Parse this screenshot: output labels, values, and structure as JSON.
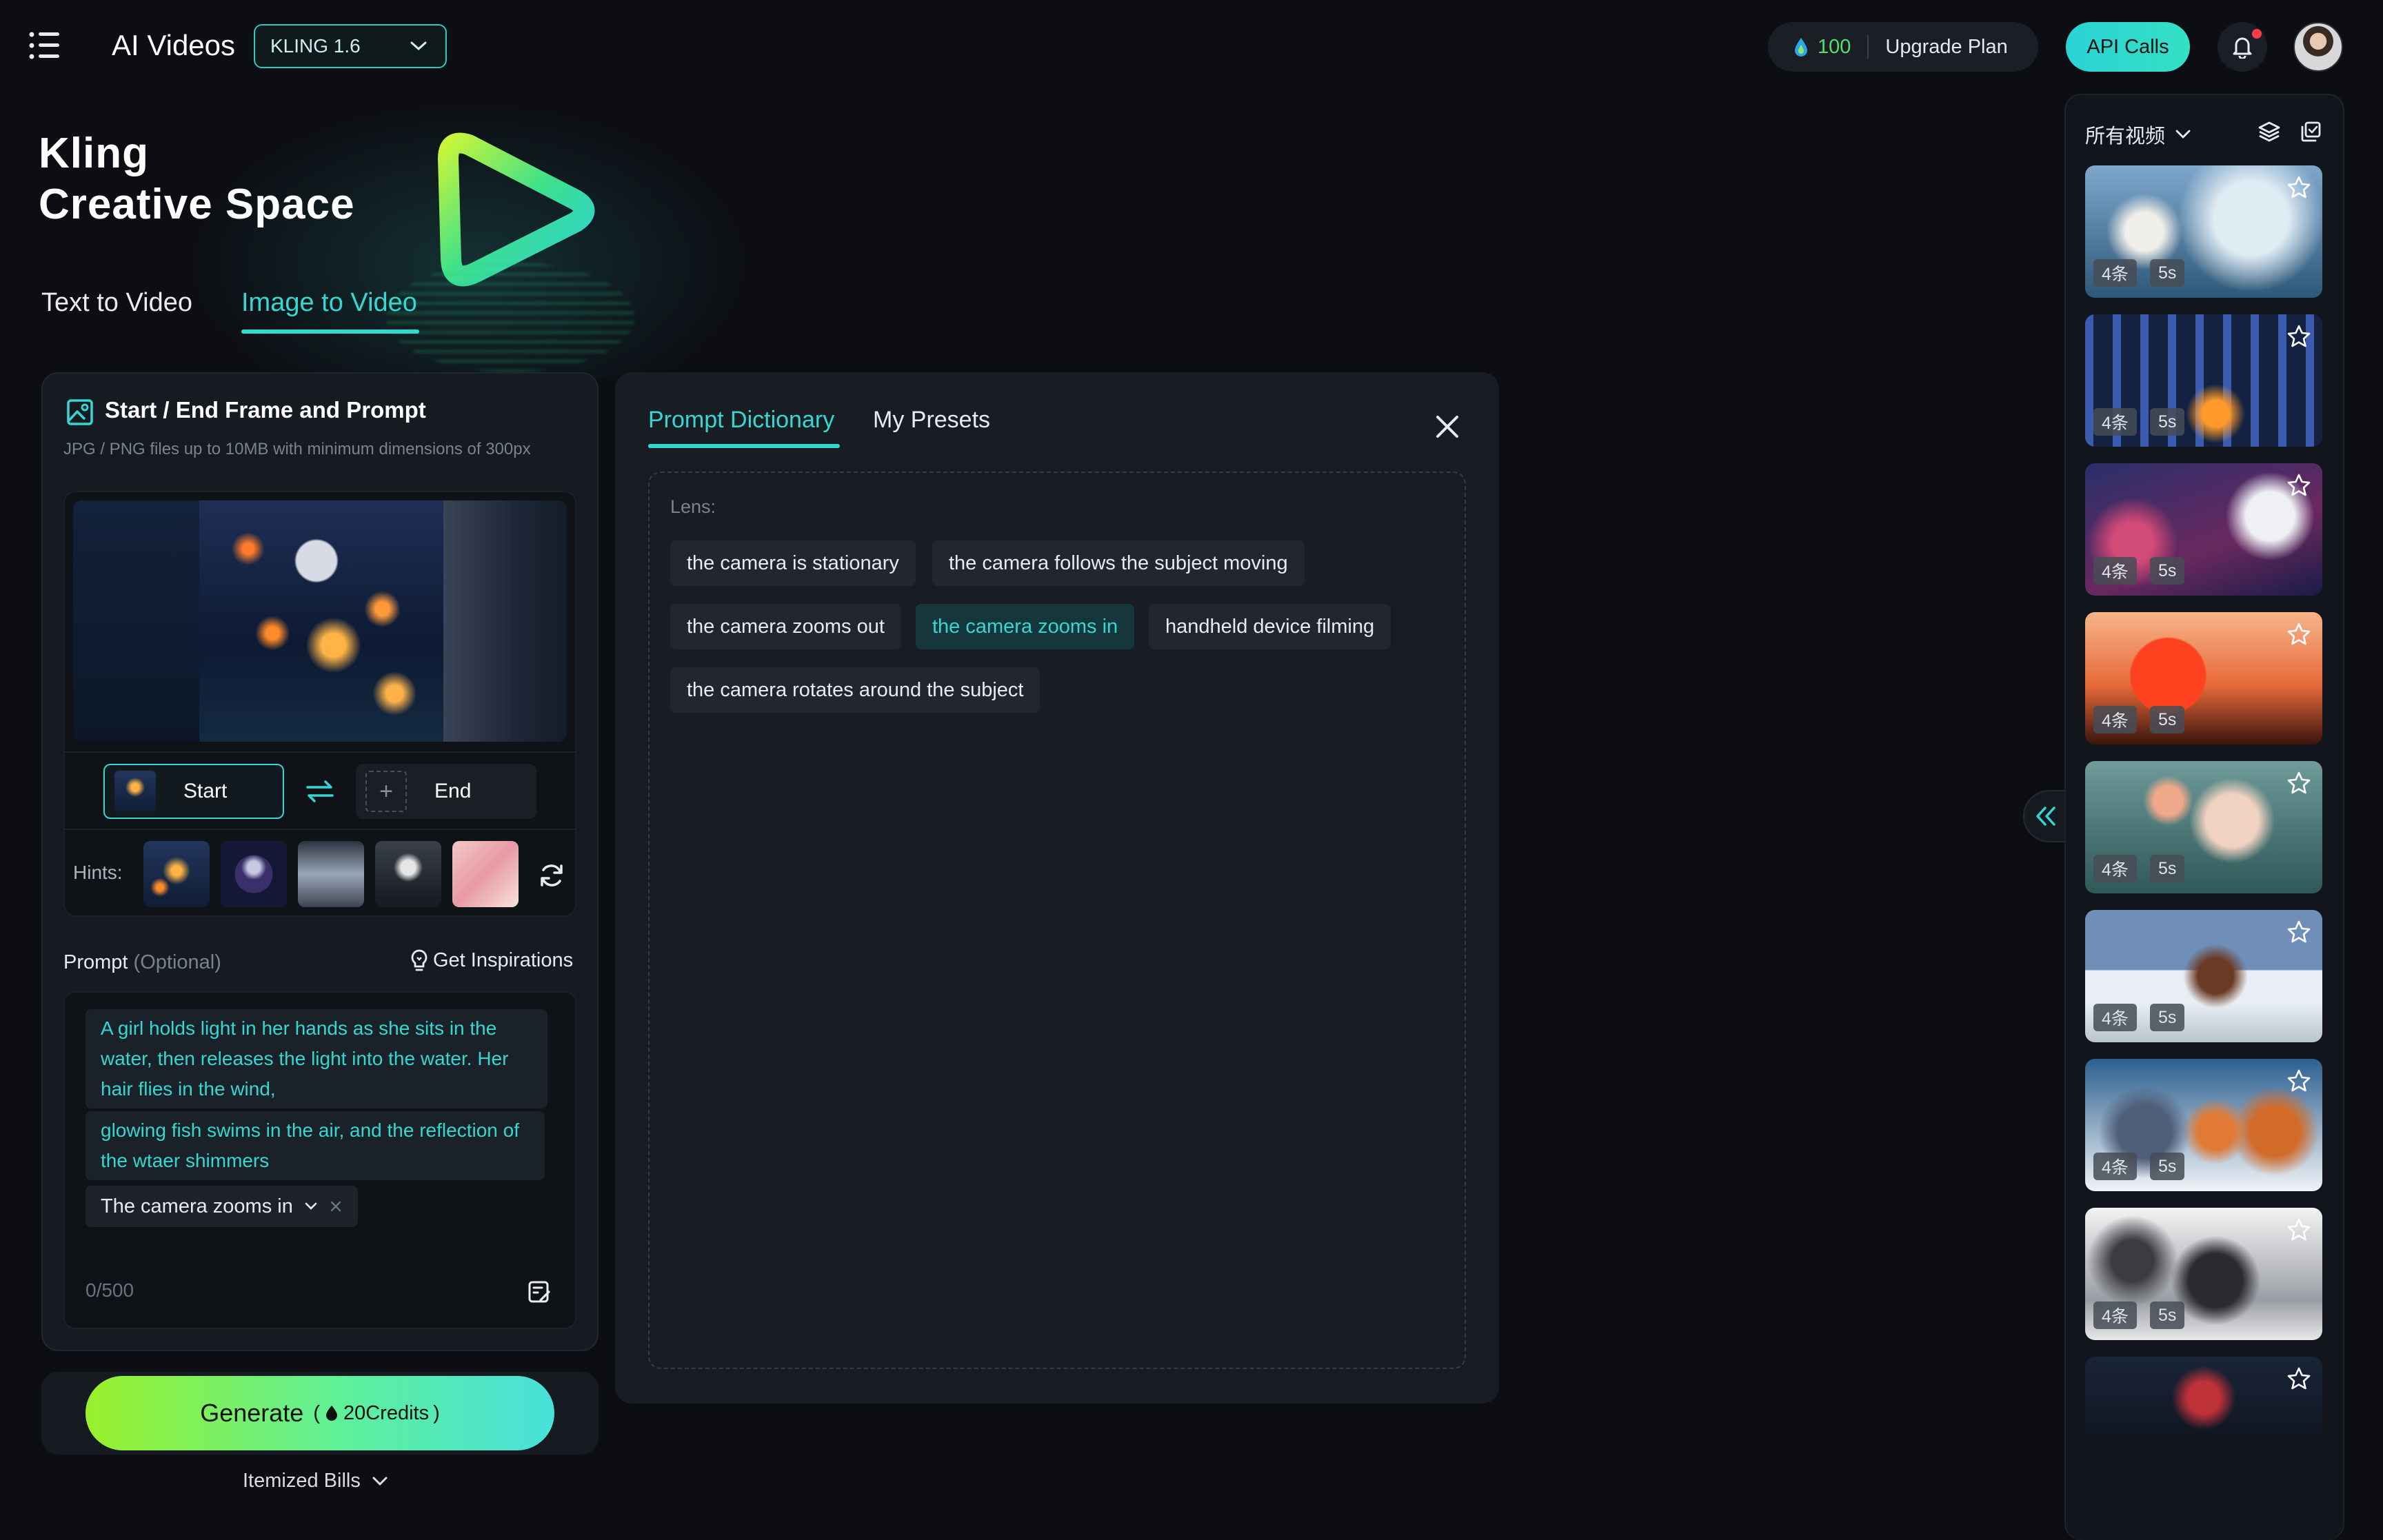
{
  "header": {
    "app_title": "AI Videos",
    "model_select": "KLING 1.6",
    "credits": "100",
    "upgrade_label": "Upgrade Plan",
    "api_label": "API Calls"
  },
  "hero": {
    "title_line1": "Kling",
    "title_line2": "Creative Space",
    "tabs": [
      "Text to Video",
      "Image to Video"
    ],
    "active_tab": "Image to Video"
  },
  "frame_panel": {
    "title": "Start / End Frame and Prompt",
    "subtitle": "JPG / PNG files up to 10MB with minimum dimensions of 300px",
    "start_label": "Start",
    "end_label": "End",
    "hints_label": "Hints:"
  },
  "prompt": {
    "label": "Prompt",
    "optional": "(Optional)",
    "inspirations": "Get Inspirations",
    "chunk1": "A girl holds light in her hands as she sits in the water, then releases the light into the water. Her hair flies in the wind,",
    "chunk2": "glowing fish swims in the air, and the reflection of the wtaer shimmers",
    "camera_chip": "The camera zooms in",
    "counter": "0/500"
  },
  "generate": {
    "label": "Generate",
    "credits": "20Credits",
    "itemized": "Itemized Bills"
  },
  "dictionary": {
    "tabs": [
      "Prompt Dictionary",
      "My Presets"
    ],
    "active_tab": "Prompt Dictionary",
    "section_label": "Lens:",
    "tags": [
      "the camera is stationary",
      "the camera follows the subject moving",
      "the camera zooms out",
      "the camera zooms in",
      "handheld device filming",
      "the camera rotates around the subject"
    ],
    "active_tag": "the camera zooms in"
  },
  "sidebar": {
    "filter": "所有视频",
    "thumbnails": [
      {
        "count": "4条",
        "duration": "5s"
      },
      {
        "count": "4条",
        "duration": "5s"
      },
      {
        "count": "4条",
        "duration": "5s"
      },
      {
        "count": "4条",
        "duration": "5s"
      },
      {
        "count": "4条",
        "duration": "5s"
      },
      {
        "count": "4条",
        "duration": "5s"
      },
      {
        "count": "4条",
        "duration": "5s"
      },
      {
        "count": "4条",
        "duration": "5s"
      }
    ]
  },
  "colors": {
    "accent": "#35d7d2",
    "credit_green": "#52e06b",
    "notification": "#ff3b4a"
  }
}
